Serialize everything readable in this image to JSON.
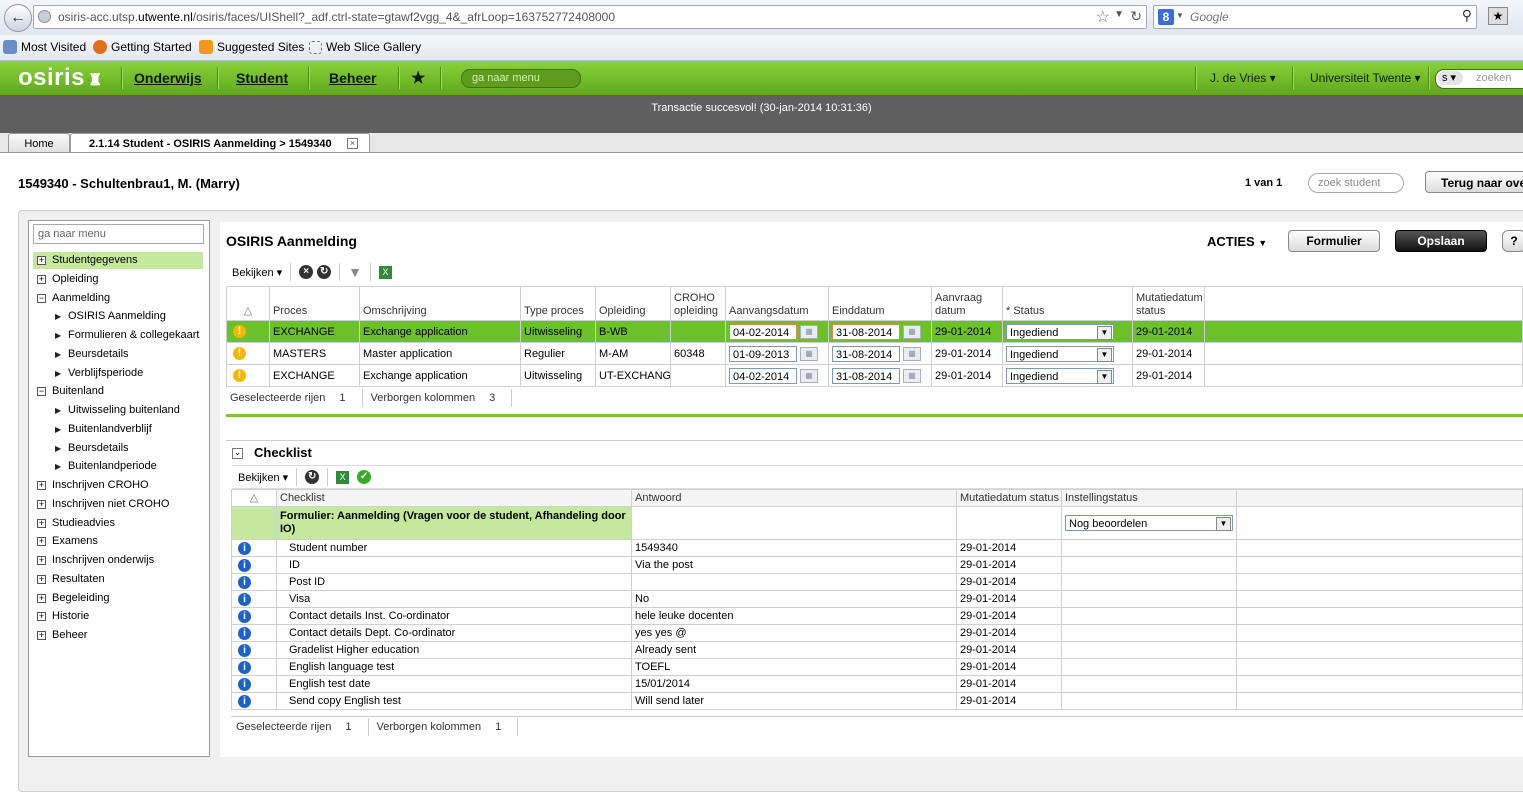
{
  "browser": {
    "url_prefix": "osiris-acc.utsp.",
    "url_domain": "utwente.nl",
    "url_suffix": "/osiris/faces/UIShell?_adf.ctrl-state=gtawf2vgg_4&_afrLoop=163752772408000",
    "search_placeholder": "Google",
    "bookmarks": [
      "Most Visited",
      "Getting Started",
      "Suggested Sites",
      "Web Slice Gallery"
    ]
  },
  "topnav": {
    "logo": "osiris",
    "items": [
      "Onderwijs",
      "Student",
      "Beheer"
    ],
    "menu_placeholder": "ga naar menu",
    "user": "J. de Vries",
    "institution": "Universiteit Twente",
    "search_scope": "s",
    "search_placeholder": "zoeken"
  },
  "message": "Transactie succesvol! (30-jan-2014 10:31:36)",
  "tabs": {
    "home": "Home",
    "active": "2.1.14 Student - OSIRIS Aanmelding > 1549340"
  },
  "student": {
    "title": "1549340 - Schultenbrau1, M. (Marry)",
    "pager": "1 van 1",
    "search_placeholder": "zoek student",
    "back_label": "Terug naar ove"
  },
  "sidebar": {
    "search_placeholder": "ga naar menu",
    "items": [
      {
        "label": "Studentgegevens",
        "type": "plus",
        "selected": true
      },
      {
        "label": "Opleiding",
        "type": "plus"
      },
      {
        "label": "Aanmelding",
        "type": "minus"
      },
      {
        "label": "OSIRIS Aanmelding",
        "type": "child"
      },
      {
        "label": "Formulieren & collegekaart",
        "type": "child"
      },
      {
        "label": "Beursdetails",
        "type": "child"
      },
      {
        "label": "Verblijfsperiode",
        "type": "child"
      },
      {
        "label": "Buitenland",
        "type": "minus"
      },
      {
        "label": "Uitwisseling buitenland",
        "type": "child"
      },
      {
        "label": "Buitenlandverblijf",
        "type": "child"
      },
      {
        "label": "Beursdetails",
        "type": "child"
      },
      {
        "label": "Buitenlandperiode",
        "type": "child"
      },
      {
        "label": "Inschrijven CROHO",
        "type": "plus"
      },
      {
        "label": "Inschrijven niet CROHO",
        "type": "plus"
      },
      {
        "label": "Studieadvies",
        "type": "plus"
      },
      {
        "label": "Examens",
        "type": "plus"
      },
      {
        "label": "Inschrijven onderwijs",
        "type": "plus"
      },
      {
        "label": "Resultaten",
        "type": "plus"
      },
      {
        "label": "Begeleiding",
        "type": "plus"
      },
      {
        "label": "Historie",
        "type": "plus"
      },
      {
        "label": "Beheer",
        "type": "plus"
      }
    ]
  },
  "panel": {
    "title": "OSIRIS Aanmelding",
    "acties": "ACTIES",
    "formulier": "Formulier",
    "opslaan": "Opslaan",
    "help": "?",
    "view_label": "Bekijken",
    "columns": [
      "Proces",
      "Omschrijving",
      "Type proces",
      "Opleiding",
      "CROHO opleiding",
      "Aanvangsdatum",
      "Einddatum",
      "Aanvraag datum",
      "* Status",
      "Mutatiedatum status"
    ],
    "rows": [
      {
        "proces": "EXCHANGE",
        "omschrijving": "Exchange application",
        "type": "Uitwisseling",
        "opleiding": "B-WB",
        "croho": "",
        "aanvang": "04-02-2014",
        "eind": "31-08-2014",
        "aanvraag": "29-01-2014",
        "status": "Ingediend",
        "mutatie": "29-01-2014",
        "selected": true
      },
      {
        "proces": "MASTERS",
        "omschrijving": "Master application",
        "type": "Regulier",
        "opleiding": "M-AM",
        "croho": "60348",
        "aanvang": "01-09-2013",
        "eind": "31-08-2014",
        "aanvraag": "29-01-2014",
        "status": "Ingediend",
        "mutatie": "29-01-2014"
      },
      {
        "proces": "EXCHANGE",
        "omschrijving": "Exchange application",
        "type": "Uitwisseling",
        "opleiding": "UT-EXCHANGE",
        "croho": "",
        "aanvang": "04-02-2014",
        "eind": "31-08-2014",
        "aanvraag": "29-01-2014",
        "status": "Ingediend",
        "mutatie": "29-01-2014"
      }
    ],
    "footer_selected_label": "Geselecteerde rijen",
    "footer_selected_value": "1",
    "footer_hidden_label": "Verborgen kolommen",
    "footer_hidden_value": "3"
  },
  "checklist": {
    "title": "Checklist",
    "view_label": "Bekijken",
    "columns": [
      "Checklist",
      "Antwoord",
      "Mutatiedatum status",
      "Instellingstatus"
    ],
    "group": "Formulier: Aanmelding (Vragen voor de student, Afhandeling door IO)",
    "group_status": "Nog beoordelen",
    "rows": [
      {
        "item": "Student number",
        "answer": "1549340",
        "date": "29-01-2014"
      },
      {
        "item": "ID",
        "answer": "Via the post",
        "date": "29-01-2014"
      },
      {
        "item": "Post ID",
        "answer": "",
        "date": "29-01-2014"
      },
      {
        "item": "Visa",
        "answer": "No",
        "date": "29-01-2014"
      },
      {
        "item": "Contact details Inst. Co-ordinator",
        "answer": "hele leuke docenten",
        "date": "29-01-2014"
      },
      {
        "item": "Contact details Dept. Co-ordinator",
        "answer": "yes yes @",
        "date": "29-01-2014"
      },
      {
        "item": "Gradelist Higher education",
        "answer": "Already sent",
        "date": "29-01-2014"
      },
      {
        "item": "English language test",
        "answer": "TOEFL",
        "date": "29-01-2014"
      },
      {
        "item": "English test date",
        "answer": "15/01/2014",
        "date": "29-01-2014"
      },
      {
        "item": "Send copy English test",
        "answer": "Will send later",
        "date": "29-01-2014"
      }
    ],
    "footer_selected_label": "Geselecteerde rijen",
    "footer_selected_value": "1",
    "footer_hidden_label": "Verborgen kolommen",
    "footer_hidden_value": "1"
  }
}
